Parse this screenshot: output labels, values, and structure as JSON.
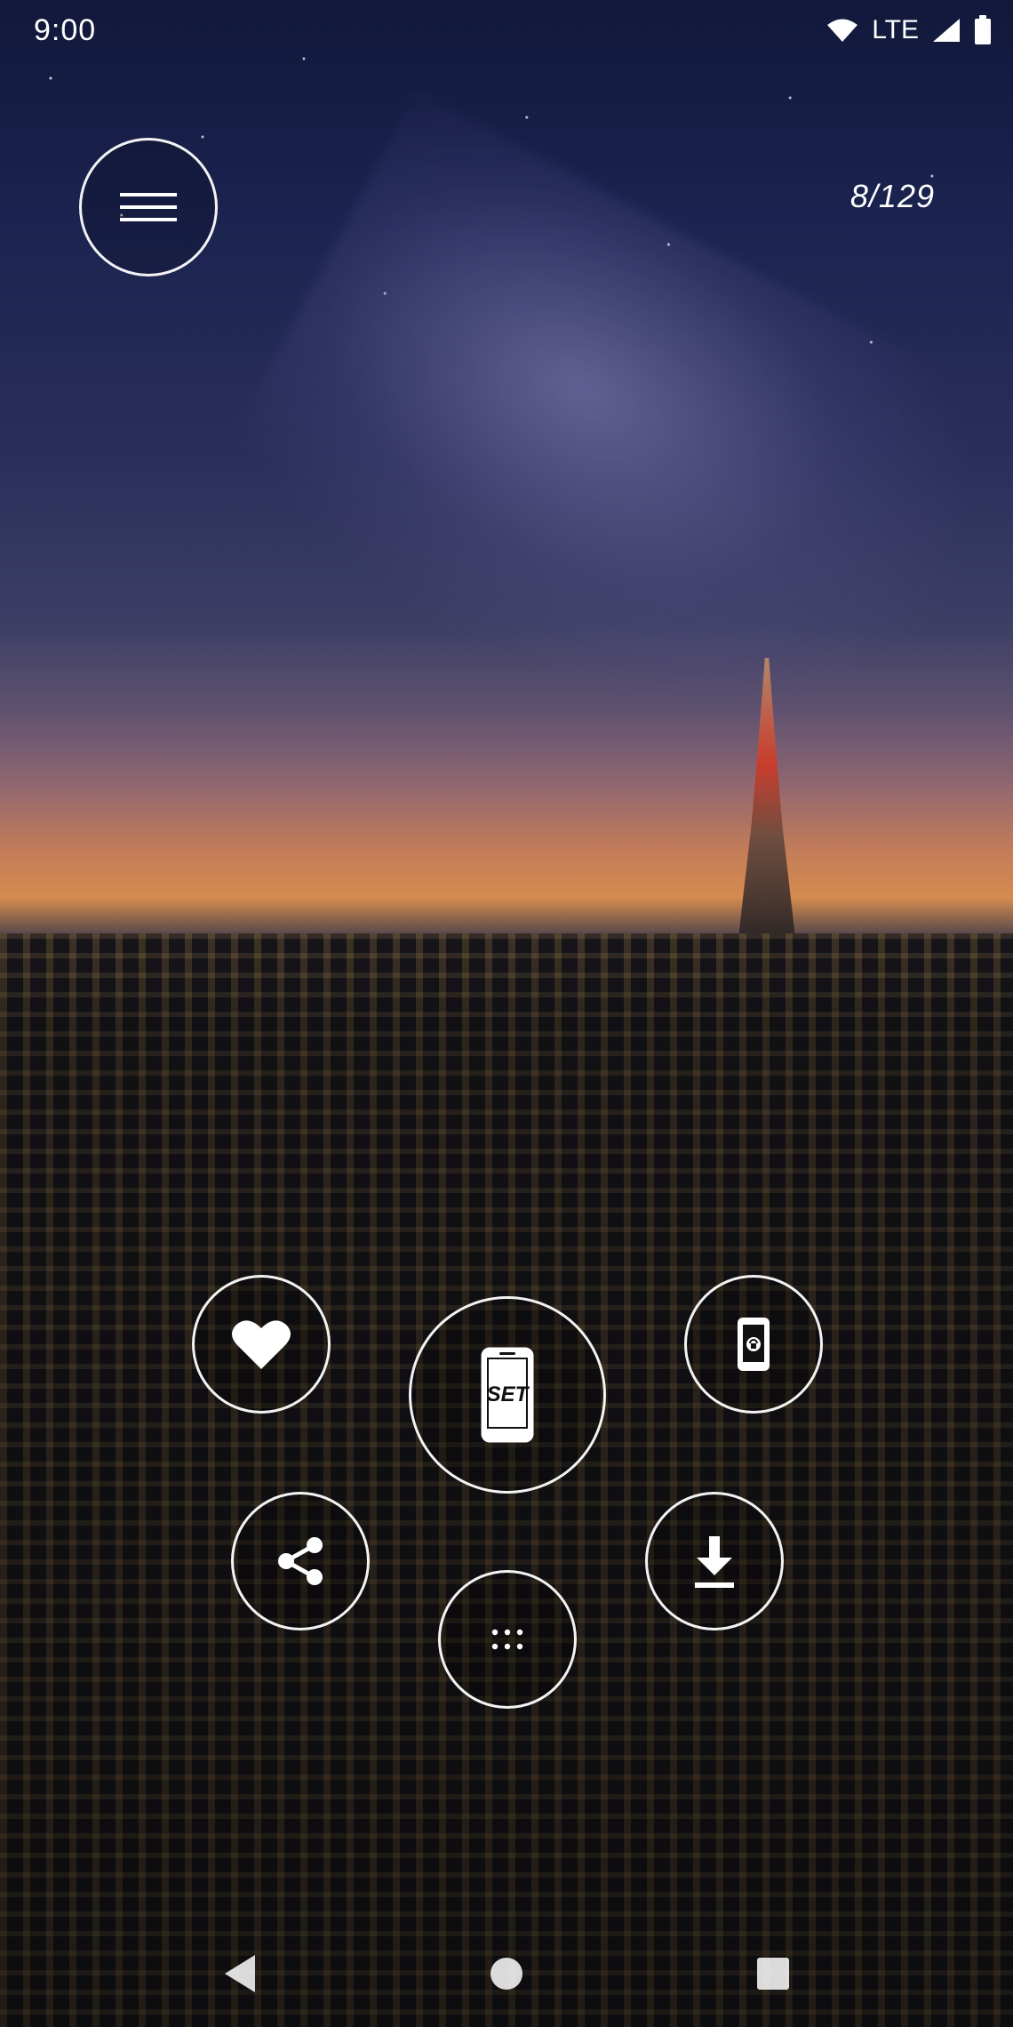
{
  "status_bar": {
    "time": "9:00",
    "network": "LTE",
    "icons": [
      "wifi-icon",
      "cellular-signal-icon",
      "battery-icon"
    ]
  },
  "header": {
    "counter": "8/129",
    "menu_icon": "hamburger-menu-icon"
  },
  "actions": {
    "favorite_icon": "heart-icon",
    "set_label": "SET",
    "lock_icon": "phone-lock-icon",
    "share_icon": "share-icon",
    "download_icon": "download-icon",
    "more_icon": "more-dots-icon"
  },
  "nav": {
    "icons": [
      "back-icon",
      "home-icon",
      "recents-icon"
    ]
  },
  "colors": {
    "icon": "#ffffff",
    "sunset_orange": "#d58b4f",
    "sky_top": "#11183a",
    "tower_red": "#cc3b2a"
  }
}
